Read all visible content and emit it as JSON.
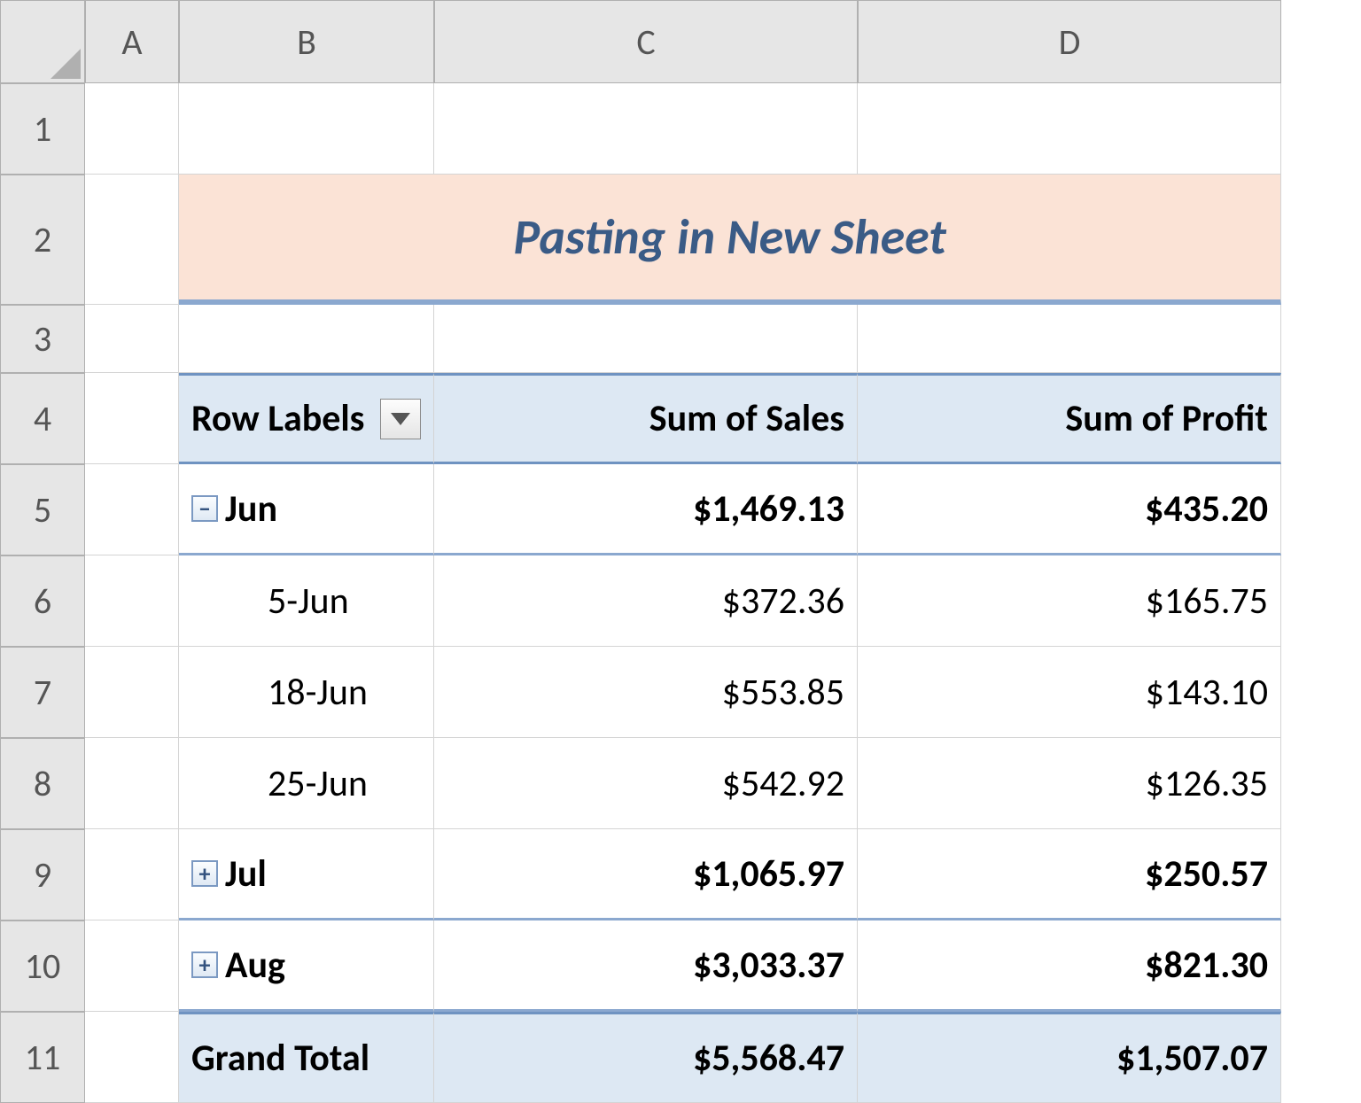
{
  "columns": [
    "A",
    "B",
    "C",
    "D"
  ],
  "rows": [
    "1",
    "2",
    "3",
    "4",
    "5",
    "6",
    "7",
    "8",
    "9",
    "10",
    "11"
  ],
  "title": "Pasting in New Sheet",
  "pivot": {
    "headers": {
      "row_labels": "Row Labels",
      "sales": "Sum of Sales",
      "profit": "Sum of Profit"
    },
    "groups": [
      {
        "label": "Jun",
        "expanded": true,
        "sales": "$1,469.13",
        "profit": "$435.20",
        "details": [
          {
            "label": "5-Jun",
            "sales": "$372.36",
            "profit": "$165.75"
          },
          {
            "label": "18-Jun",
            "sales": "$553.85",
            "profit": "$143.10"
          },
          {
            "label": "25-Jun",
            "sales": "$542.92",
            "profit": "$126.35"
          }
        ]
      },
      {
        "label": "Jul",
        "expanded": false,
        "sales": "$1,065.97",
        "profit": "$250.57",
        "details": []
      },
      {
        "label": "Aug",
        "expanded": false,
        "sales": "$3,033.37",
        "profit": "$821.30",
        "details": []
      }
    ],
    "grand_total": {
      "label": "Grand Total",
      "sales": "$5,568.47",
      "profit": "$1,507.07"
    }
  },
  "icons": {
    "minus": "−",
    "plus": "+"
  }
}
